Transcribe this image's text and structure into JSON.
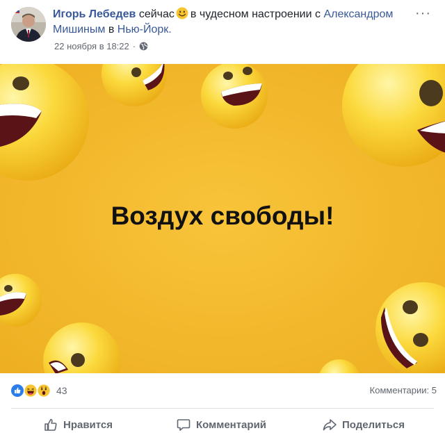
{
  "post": {
    "author": "Игорь Лебедев",
    "status_prefix": "сейчас",
    "status_suffix": "в чудесном настроении с",
    "friend": "Александром Мишиным",
    "location_prefix": "в",
    "location": "Нью-Йорк.",
    "timestamp": "22 ноября в 18:22",
    "separator": "·",
    "more_icon": "···",
    "privacy_icon": "globe-icon",
    "mood_emoji": "smiling-face-icon"
  },
  "image": {
    "caption": "Воздух свободы!",
    "background": "#f6bd33"
  },
  "reactions": {
    "icons": [
      "like-icon",
      "haha-icon",
      "wow-icon"
    ],
    "count": "43",
    "comments": "Комментарии: 5"
  },
  "actions": {
    "like": "Нравится",
    "comment": "Комментарий",
    "share": "Поделиться"
  },
  "colors": {
    "link": "#385898",
    "secondary": "#606770"
  }
}
